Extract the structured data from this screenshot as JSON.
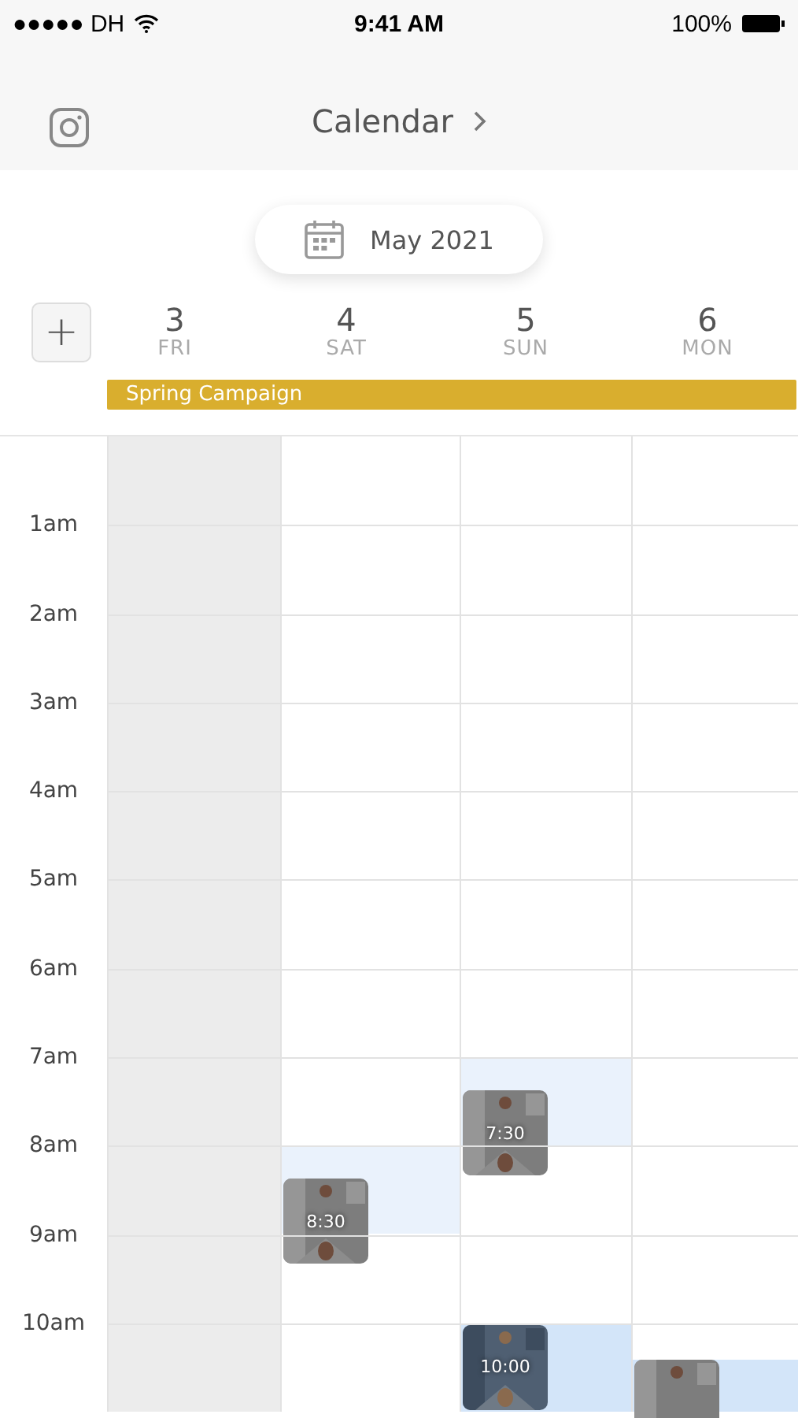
{
  "status_bar": {
    "carrier": "●●●●● DH",
    "time": "9:41 AM",
    "battery": "100%"
  },
  "nav": {
    "title": "Calendar"
  },
  "month_button": {
    "label": "May 2021"
  },
  "add_button": {
    "label": "+"
  },
  "days": [
    {
      "number": "3",
      "weekday": "FRI",
      "shaded": true
    },
    {
      "number": "4",
      "weekday": "SAT",
      "shaded": false
    },
    {
      "number": "5",
      "weekday": "SUN",
      "shaded": false
    },
    {
      "number": "6",
      "weekday": "MON",
      "shaded": false
    }
  ],
  "campaign": {
    "label": "Spring Campaign"
  },
  "rows": [
    {
      "cells": [
        {},
        {},
        {},
        {}
      ]
    },
    {
      "hour": "1am",
      "cells": [
        {},
        {},
        {},
        {}
      ]
    },
    {
      "hour": "2am",
      "cells": [
        {},
        {},
        {},
        {}
      ]
    },
    {
      "hour": "3am",
      "cells": [
        {},
        {},
        {},
        {}
      ]
    },
    {
      "hour": "4am",
      "cells": [
        {},
        {},
        {},
        {}
      ]
    },
    {
      "hour": "5am",
      "cells": [
        {},
        {},
        {},
        {}
      ]
    },
    {
      "hour": "6am",
      "cells": [
        {},
        {},
        {},
        {}
      ]
    },
    {
      "hour": "7am",
      "cells": [
        {},
        {},
        {
          "event": {
            "time": "7:30",
            "half_hour": true,
            "selected": false
          }
        },
        {}
      ]
    },
    {
      "hour": "8am",
      "cells": [
        {},
        {
          "event": {
            "time": "8:30",
            "half_hour": true,
            "selected": false
          }
        },
        {},
        {}
      ]
    },
    {
      "hour": "9am",
      "cells": [
        {},
        {},
        {},
        {}
      ]
    },
    {
      "hour": "10am",
      "cells": [
        {},
        {},
        {
          "event": {
            "time": "10:00",
            "half_hour": false,
            "selected": true
          }
        },
        {
          "event": {
            "half_hour": true,
            "selected": true
          }
        }
      ]
    }
  ]
}
